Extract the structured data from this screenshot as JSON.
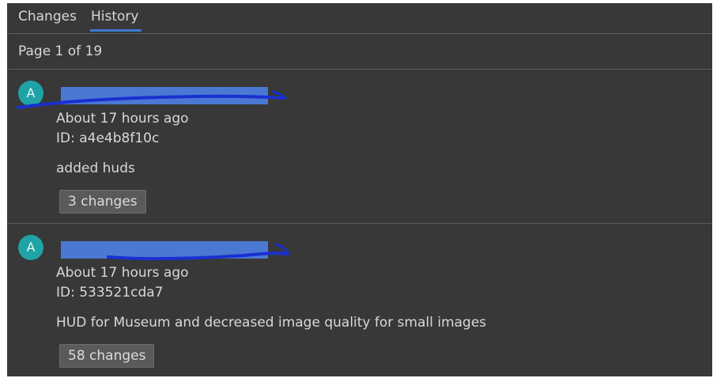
{
  "tabs": [
    {
      "label": "Changes"
    },
    {
      "label": "History"
    }
  ],
  "pager": {
    "text": "Page 1 of 19"
  },
  "entries": [
    {
      "avatar_initial": "A",
      "time": "About 17 hours ago",
      "id": "ID: a4e4b8f10c",
      "message": "added huds",
      "changes": "3 changes"
    },
    {
      "avatar_initial": "A",
      "time": "About 17 hours ago",
      "id": "ID: 533521cda7",
      "message": "HUD for Museum and decreased image quality for small images",
      "changes": "58 changes"
    }
  ],
  "colors": {
    "background": "#383838",
    "accent": "#3d7bd2",
    "avatar": "#1fa3a6",
    "redaction": "#4a78d3"
  }
}
